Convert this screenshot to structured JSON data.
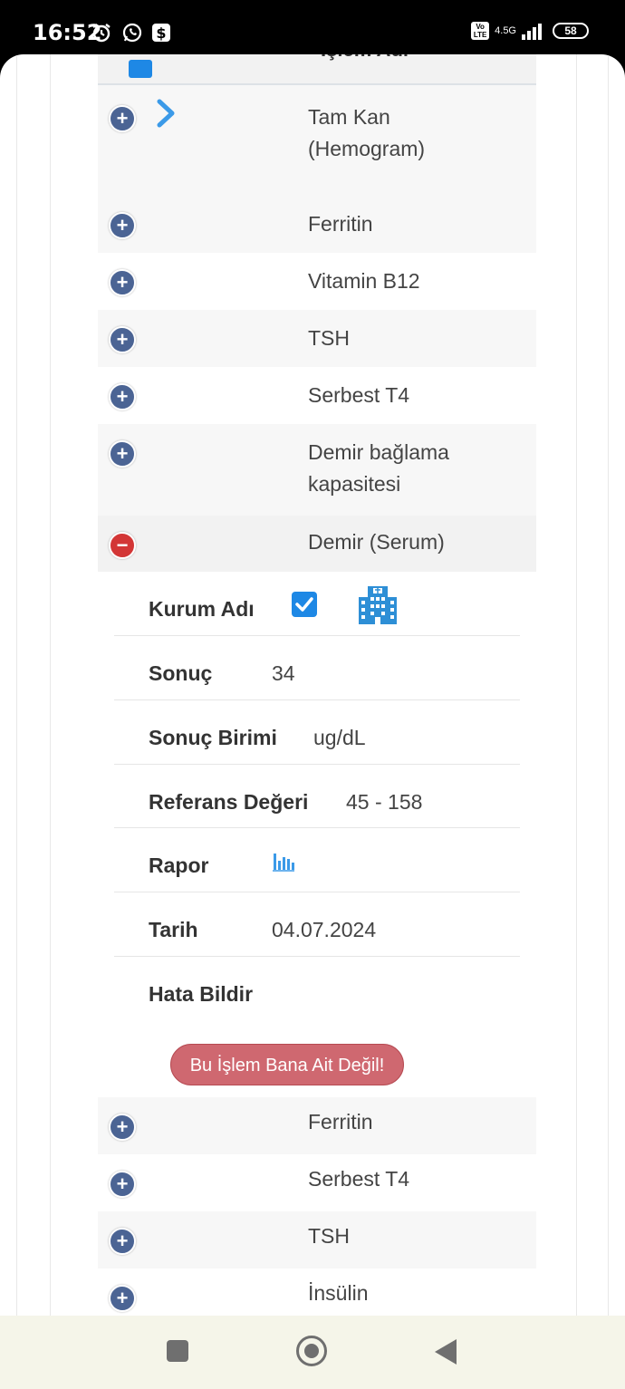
{
  "status_bar": {
    "time": "16:52",
    "network": "4.5G",
    "battery": "58",
    "volte": "Vo LTE"
  },
  "table": {
    "header": "İşlem Adı",
    "rows_top": [
      {
        "name_line1": "Tam Kan",
        "name_line2": "(Hemogram)",
        "toggle": "+"
      },
      {
        "name_line1": "Ferritin",
        "toggle": "+"
      },
      {
        "name_line1": "Vitamin B12",
        "toggle": "+"
      },
      {
        "name_line1": "TSH",
        "toggle": "+"
      },
      {
        "name_line1": "Serbest T4",
        "toggle": "+"
      },
      {
        "name_line1": "Demir bağlama",
        "name_line2": "kapasitesi",
        "toggle": "+"
      },
      {
        "name_line1": "Demir (Serum)",
        "toggle": "−"
      }
    ],
    "detail": {
      "kurum_label": "Kurum Adı",
      "sonuc_label": "Sonuç",
      "sonuc_value": "34",
      "birim_label": "Sonuç Birimi",
      "birim_value": "ug/dL",
      "referans_label": "Referans Değeri",
      "referans_value": "45 - 158",
      "rapor_label": "Rapor",
      "tarih_label": "Tarih",
      "tarih_value": "04.07.2024",
      "hata_label": "Hata Bildir",
      "hata_button": "Bu İşlem Bana Ait Değil!"
    },
    "rows_bottom": [
      {
        "name_line1": "Ferritin",
        "toggle": "+"
      },
      {
        "name_line1": "Serbest T4",
        "toggle": "+"
      },
      {
        "name_line1": "TSH",
        "toggle": "+"
      },
      {
        "name_line1": "İnsülin",
        "toggle": "+"
      }
    ]
  },
  "icons": {
    "chevron": "chevron-right-icon",
    "hospital": "hospital-building-icon",
    "report": "bar-chart-icon",
    "accent": "#1e88e5",
    "toggle_plus": "#4b6494",
    "toggle_minus": "#d33636",
    "error_button": "#cf6870"
  }
}
